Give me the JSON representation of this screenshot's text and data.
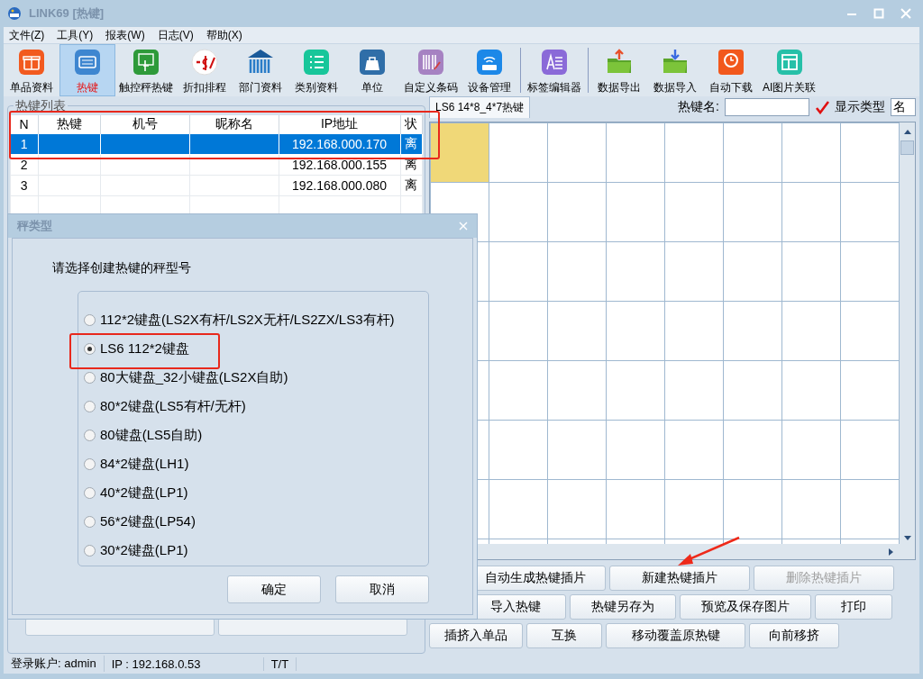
{
  "window": {
    "title": "LINK69 [热键]"
  },
  "menu": [
    "文件(Z)",
    "工具(Y)",
    "报表(W)",
    "日志(V)",
    "帮助(X)"
  ],
  "toolbar": [
    {
      "items": [
        {
          "label": "单品资料",
          "selected": false
        },
        {
          "label": "热键",
          "selected": true
        },
        {
          "label": "触控秤热键",
          "selected": false
        },
        {
          "label": "折扣排程",
          "selected": false
        },
        {
          "label": "部门资料",
          "selected": false
        },
        {
          "label": "类别资料",
          "selected": false
        },
        {
          "label": "单位",
          "selected": false
        },
        {
          "label": "自定义条码",
          "selected": false
        },
        {
          "label": "设备管理",
          "selected": false
        }
      ]
    },
    {
      "items": [
        {
          "label": "标签编辑器",
          "selected": false
        }
      ]
    },
    {
      "items": [
        {
          "label": "数据导出",
          "selected": false
        },
        {
          "label": "数据导入",
          "selected": false
        },
        {
          "label": "自动下载",
          "selected": false
        },
        {
          "label": "AI图片关联",
          "selected": false
        }
      ]
    }
  ],
  "hotkey_list": {
    "title": "热键列表",
    "columns": [
      "N",
      "热键",
      "机号",
      "昵称名",
      "IP地址",
      "状"
    ],
    "rows": [
      {
        "cells": [
          "1",
          "",
          "",
          "",
          "192.168.000.170",
          "离"
        ],
        "selected": true
      },
      {
        "cells": [
          "2",
          "",
          "",
          "",
          "192.168.000.155",
          "离"
        ],
        "selected": false
      },
      {
        "cells": [
          "3",
          "",
          "",
          "",
          "192.168.000.080",
          "离"
        ],
        "selected": false
      }
    ]
  },
  "editor": {
    "tab": "LS6 14*8_4*7热键",
    "name_label": "热键名:",
    "show_type_checked": true,
    "show_type_label": "显示类型",
    "show_type_value": "名",
    "grid": [
      {
        "cells": [
          {
            "selected": true
          },
          {
            "selected": false
          },
          {
            "selected": false
          },
          {
            "selected": false
          },
          {
            "selected": false
          },
          {
            "selected": false
          },
          {
            "selected": false
          },
          {
            "selected": false
          }
        ]
      },
      {
        "cells": [
          {
            "selected": false
          },
          {
            "selected": false
          },
          {
            "selected": false
          },
          {
            "selected": false
          },
          {
            "selected": false
          },
          {
            "selected": false
          },
          {
            "selected": false
          },
          {
            "selected": false
          }
        ]
      },
      {
        "cells": [
          {
            "selected": false
          },
          {
            "selected": false
          },
          {
            "selected": false
          },
          {
            "selected": false
          },
          {
            "selected": false
          },
          {
            "selected": false
          },
          {
            "selected": false
          },
          {
            "selected": false
          }
        ]
      },
      {
        "cells": [
          {
            "selected": false
          },
          {
            "selected": false
          },
          {
            "selected": false
          },
          {
            "selected": false
          },
          {
            "selected": false
          },
          {
            "selected": false
          },
          {
            "selected": false
          },
          {
            "selected": false
          }
        ]
      },
      {
        "cells": [
          {
            "selected": false
          },
          {
            "selected": false
          },
          {
            "selected": false
          },
          {
            "selected": false
          },
          {
            "selected": false
          },
          {
            "selected": false
          },
          {
            "selected": false
          },
          {
            "selected": false
          }
        ]
      },
      {
        "cells": [
          {
            "selected": false
          },
          {
            "selected": false
          },
          {
            "selected": false
          },
          {
            "selected": false
          },
          {
            "selected": false
          },
          {
            "selected": false
          },
          {
            "selected": false
          },
          {
            "selected": false
          }
        ]
      },
      {
        "cells": [
          {
            "selected": false
          },
          {
            "selected": false
          },
          {
            "selected": false
          },
          {
            "selected": false
          },
          {
            "selected": false
          },
          {
            "selected": false
          },
          {
            "selected": false
          },
          {
            "selected": false
          }
        ]
      },
      {
        "cells": [
          {
            "selected": false
          },
          {
            "selected": false
          },
          {
            "selected": false
          },
          {
            "selected": false
          },
          {
            "selected": false
          },
          {
            "selected": false
          },
          {
            "selected": false
          },
          {
            "selected": false
          }
        ]
      }
    ],
    "button_rows": [
      [
        {
          "label": "自动生成热键插片",
          "disabled": false
        },
        {
          "label": "新建热键插片",
          "disabled": false
        },
        {
          "label": "删除热键插片",
          "disabled": true
        }
      ],
      [
        {
          "label": "导入热键",
          "disabled": false
        },
        {
          "label": "热键另存为",
          "disabled": false
        },
        {
          "label": "预览及保存图片",
          "disabled": false
        },
        {
          "label": "打印",
          "disabled": false
        }
      ],
      [
        {
          "label": "插挤入单品",
          "disabled": false
        },
        {
          "label": "互换",
          "disabled": false
        },
        {
          "label": "移动覆盖原热键",
          "disabled": false
        },
        {
          "label": "向前移挤",
          "disabled": false
        }
      ]
    ]
  },
  "dialog": {
    "title": "秤类型",
    "prompt": "请选择创建热键的秤型号",
    "options": [
      {
        "label": "112*2键盘(LS2X有杆/LS2X无杆/LS2ZX/LS3有杆)",
        "selected": false
      },
      {
        "label": "LS6 112*2键盘",
        "selected": true
      },
      {
        "label": "80大键盘_32小键盘(LS2X自助)",
        "selected": false
      },
      {
        "label": "80*2键盘(LS5有杆/无杆)",
        "selected": false
      },
      {
        "label": "80键盘(LS5自助)",
        "selected": false
      },
      {
        "label": "84*2键盘(LH1)",
        "selected": false
      },
      {
        "label": "40*2键盘(LP1)",
        "selected": false
      },
      {
        "label": "56*2键盘(LP54)",
        "selected": false
      },
      {
        "label": "30*2键盘(LP1)",
        "selected": false
      }
    ],
    "buttons": [
      "确定",
      "取消"
    ]
  },
  "status_bar": [
    "登录账户: admin",
    "IP : 192.168.0.53",
    "T/T"
  ]
}
